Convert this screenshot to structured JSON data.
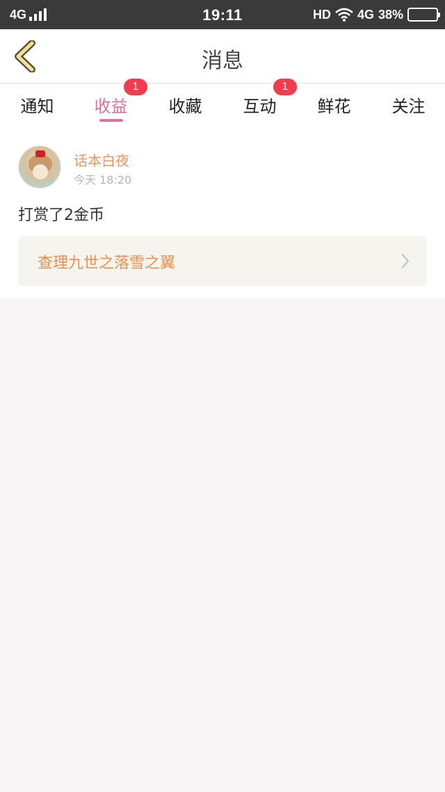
{
  "status_bar": {
    "network_left": "4G",
    "time": "19:11",
    "hd": "HD",
    "network_right": "4G",
    "battery_percent": "38%",
    "battery_level": 0.38
  },
  "header": {
    "title": "消息"
  },
  "tabs": [
    {
      "label": "通知",
      "active": false,
      "badge": null
    },
    {
      "label": "收益",
      "active": true,
      "badge": "1"
    },
    {
      "label": "收藏",
      "active": false,
      "badge": null
    },
    {
      "label": "互动",
      "active": false,
      "badge": "1"
    },
    {
      "label": "鲜花",
      "active": false,
      "badge": null
    },
    {
      "label": "关注",
      "active": false,
      "badge": null
    }
  ],
  "item": {
    "user_name": "话本白夜",
    "timestamp": "今天 18:20",
    "message": "打赏了2金币",
    "work_title": "查理九世之落雪之翼"
  },
  "colors": {
    "accent_pink": "#e0709a",
    "badge_red": "#f43c4f",
    "name_orange": "#f0955a",
    "back_yellow": "#f0e29a"
  },
  "icons": {
    "back": "chevron-left-icon",
    "wifi": "wifi-icon",
    "signal": "signal-bars-icon",
    "battery": "battery-icon",
    "link_arrow": "chevron-right-icon"
  }
}
